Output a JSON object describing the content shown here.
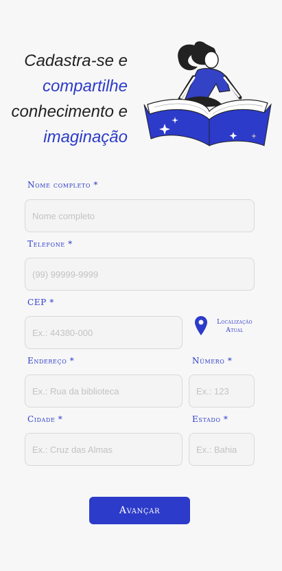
{
  "hero": {
    "line1": "Cadastra-se e",
    "line2": "compartilhe",
    "line3": "conhecimento e",
    "line4": "imaginação"
  },
  "form": {
    "name": {
      "label": "Nome completo *",
      "placeholder": "Nome completo"
    },
    "phone": {
      "label": "Telefone *",
      "placeholder": "(99) 99999-9999"
    },
    "cep": {
      "label": "CEP *",
      "placeholder": "Ex.: 44380-000"
    },
    "location_button": {
      "line1": "Localização",
      "line2": "Atual"
    },
    "address": {
      "label": "Endereço *",
      "placeholder": "Ex.: Rua da biblioteca"
    },
    "number": {
      "label": "Número *",
      "placeholder": "Ex.: 123"
    },
    "city": {
      "label": "Cidade *",
      "placeholder": "Ex.: Cruz das Almas"
    },
    "state": {
      "label": "Estado *",
      "placeholder": "Ex.: Bahia"
    }
  },
  "submit_label": "Avançar",
  "colors": {
    "accent": "#2c3bc9",
    "background": "#f7f7f7"
  },
  "icons": {
    "location": "map-pin-icon",
    "illustration": "girl-on-book-illustration"
  }
}
